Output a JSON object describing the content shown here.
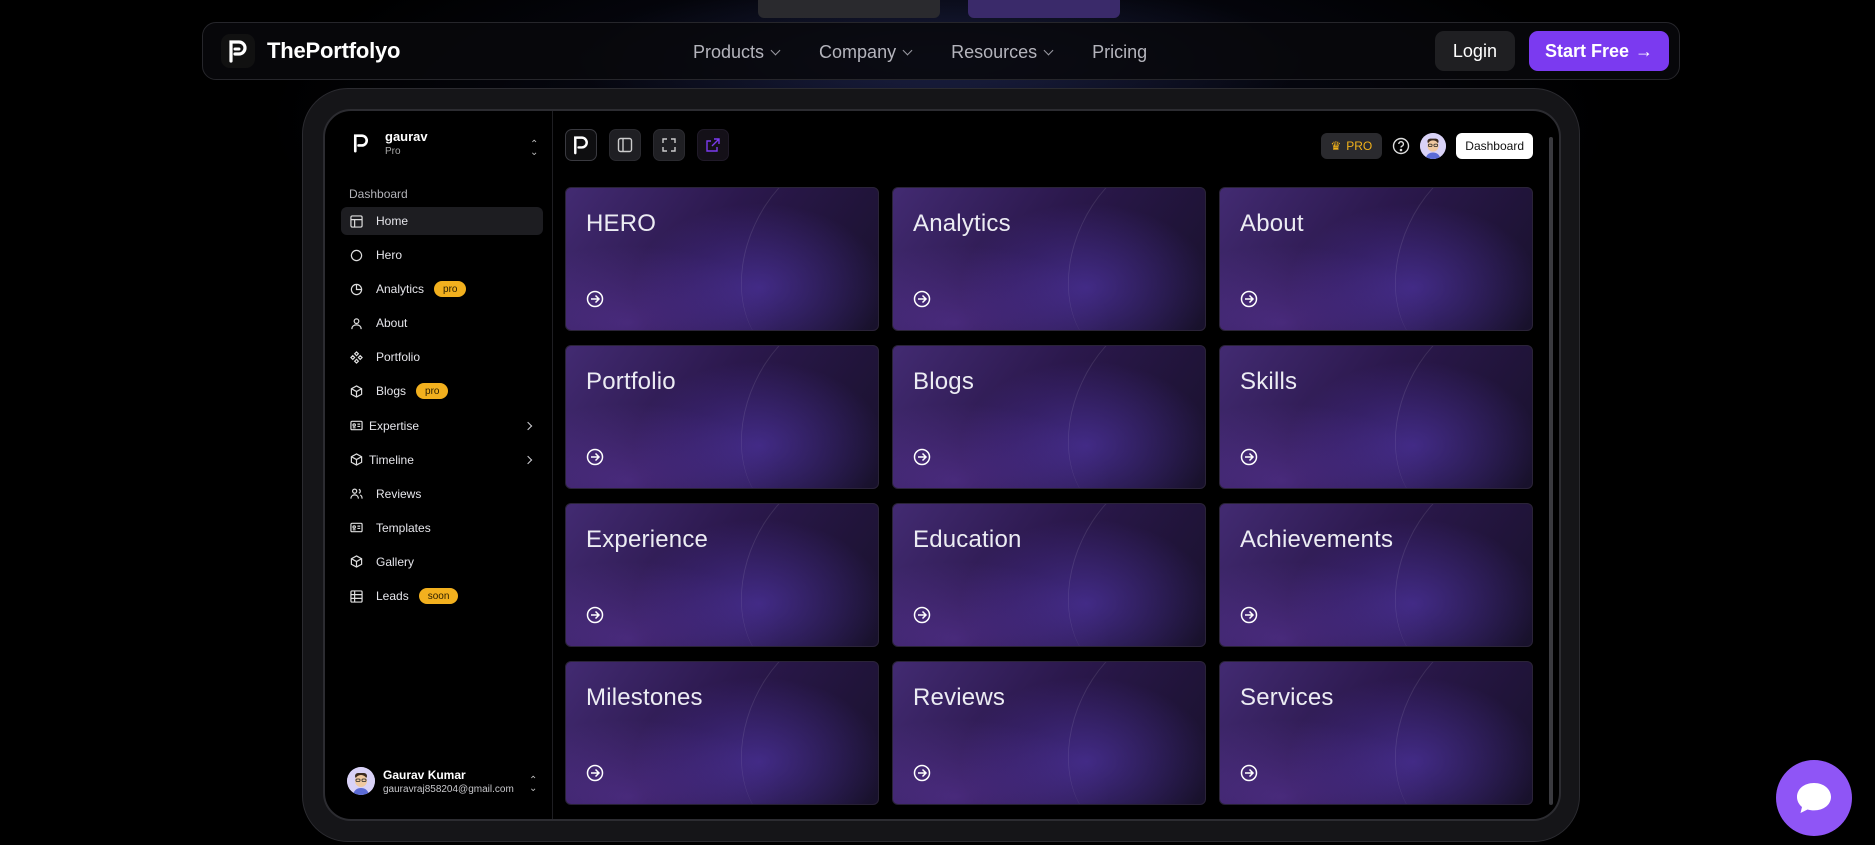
{
  "navbar": {
    "brand": "ThePortfolyo",
    "links": [
      {
        "label": "Products"
      },
      {
        "label": "Company"
      },
      {
        "label": "Resources"
      },
      {
        "label": "Pricing"
      }
    ],
    "login_label": "Login",
    "start_label": "Start Free",
    "start_arrow": "→"
  },
  "sidebar": {
    "team": {
      "name": "gaurav",
      "plan": "Pro"
    },
    "section_label": "Dashboard",
    "items": [
      {
        "label": "Home",
        "icon": "layout-icon"
      },
      {
        "label": "Hero",
        "icon": "circle-icon"
      },
      {
        "label": "Analytics",
        "icon": "pie-chart-icon",
        "badge": "pro"
      },
      {
        "label": "About",
        "icon": "user-icon"
      },
      {
        "label": "Portfolio",
        "icon": "components-icon"
      },
      {
        "label": "Blogs",
        "icon": "box-icon",
        "badge": "pro"
      },
      {
        "label": "Expertise",
        "icon": "id-card-icon"
      },
      {
        "label": "Timeline",
        "icon": "box-icon"
      },
      {
        "label": "Reviews",
        "icon": "users-icon"
      },
      {
        "label": "Templates",
        "icon": "id-card-icon"
      },
      {
        "label": "Gallery",
        "icon": "box-icon"
      },
      {
        "label": "Leads",
        "icon": "table-icon",
        "badge": "soon"
      }
    ],
    "user": {
      "name": "Gaurav Kumar",
      "email": "gauravraj858204@gmail.com"
    }
  },
  "toolbar": {
    "pro_label": "PRO",
    "dashboard_label": "Dashboard"
  },
  "cards": [
    {
      "title": "HERO"
    },
    {
      "title": "Analytics"
    },
    {
      "title": "About"
    },
    {
      "title": "Portfolio"
    },
    {
      "title": "Blogs"
    },
    {
      "title": "Skills"
    },
    {
      "title": "Experience"
    },
    {
      "title": "Education"
    },
    {
      "title": "Achievements"
    },
    {
      "title": "Milestones"
    },
    {
      "title": "Reviews"
    },
    {
      "title": "Services"
    }
  ],
  "colors": {
    "accent": "#7b3af0",
    "badge": "#f2b01e",
    "chat": "#8f55f6"
  }
}
